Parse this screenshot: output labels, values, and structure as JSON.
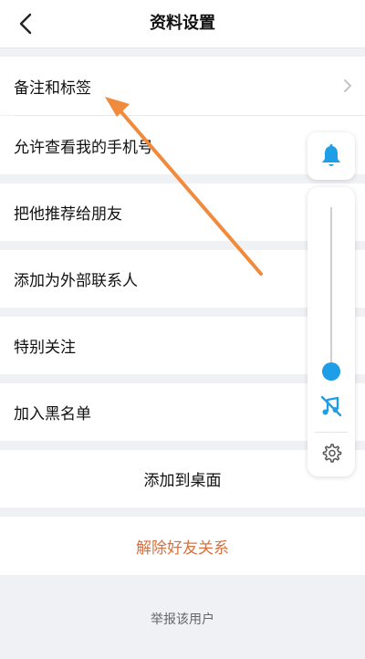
{
  "header": {
    "title": "资料设置",
    "back_icon": "chevron-left-icon"
  },
  "rows": [
    {
      "label": "备注和标签",
      "has_chevron": true
    },
    {
      "label": "允许查看我的手机号"
    },
    {
      "label": "把他推荐给朋友"
    },
    {
      "label": "添加为外部联系人"
    },
    {
      "label": "特别关注"
    },
    {
      "label": "加入黑名单"
    },
    {
      "label": "添加到桌面"
    },
    {
      "label": "解除好友关系"
    }
  ],
  "report": {
    "label": "举报该用户"
  },
  "volume_panel": {
    "level_percent": 5,
    "bell_icon": "bell-icon",
    "music_icon": "music-off-icon",
    "settings_icon": "gear-icon"
  },
  "colors": {
    "accent": "#1e9ee6",
    "danger": "#d9703e",
    "arrow": "#f08a3c"
  }
}
